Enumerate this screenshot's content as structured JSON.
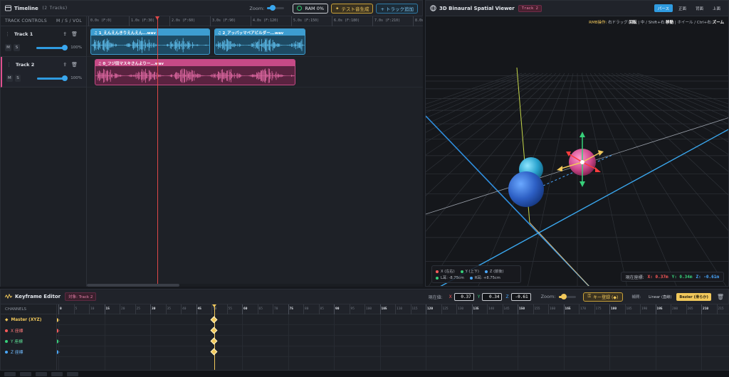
{
  "timeline": {
    "title": "Timeline",
    "track_count": "(2 Tracks)",
    "zoom_label": "Zoom:",
    "zoom_level": 0.3,
    "ram_label": "RAM 0%",
    "test_label": "テスト音生成",
    "add_track_label": "+ トラック追加",
    "controls_header": "TRACK CONTROLS",
    "controls_ms": "M / S / VOL",
    "ruler": [
      "0.0s (F:0)",
      "1.0s (F:30)",
      "2.0s (F:60)",
      "3.0s (F:90)",
      "4.0s (F:120)",
      "5.0s (F:150)",
      "6.0s (F:180)",
      "7.0s (F:210)",
      "8.0s (F:240)"
    ],
    "playhead_seconds": 1.7,
    "tracks": [
      {
        "name": "Track 1",
        "volume": "100%",
        "volume_level": 1.0,
        "clips": [
          {
            "label": "♫ 1_えんえんきりえんえん...wav",
            "start": 0.05,
            "end": 3.0
          },
          {
            "label": "♫ 2_アッパッマペアビルダー...wav",
            "start": 3.1,
            "end": 5.35
          }
        ]
      },
      {
        "name": "Track 2",
        "volume": "100%",
        "volume_level": 1.0,
        "clips": [
          {
            "label": "♫ 0_フジ田マスキさんよりー...wav",
            "start": 0.15,
            "end": 5.1
          }
        ]
      }
    ],
    "mute_label": "M",
    "solo_label": "S"
  },
  "viewer": {
    "title": "3D Binaural Spatial Viewer",
    "track_badge": "Track 2",
    "views": [
      "パース",
      "正面",
      "背面",
      "上面"
    ],
    "active_view": "パース",
    "hint_prefix": "RMB操作:",
    "hint_parts": [
      {
        "t": "右ドラッグ:",
        "b": "回転"
      },
      {
        "t": "中 / Shift+右:",
        "b": "移動"
      },
      {
        "t": "ホイール / Ctrl+右:",
        "b": "ズーム"
      }
    ],
    "legend": {
      "x": "X (左右)",
      "y": "Y (上下)",
      "z": "Z (前後)",
      "l_ear": "L耳: -8.75cm",
      "r_ear": "R耳: +8.75cm"
    },
    "coords_label": "現在座標:",
    "coord_x": "X: 0.37m",
    "coord_y": "Y: 0.34m",
    "coord_z": "Z: -0.61m",
    "colors": {
      "x": "#ff5a5a",
      "y": "#37d07a",
      "z": "#4aa8ff"
    }
  },
  "keyframe": {
    "title": "Keyframe Editor",
    "target": "対象: Track 2",
    "current_label": "現在値:",
    "x": "0.37",
    "y": "0.34",
    "z": "-0.61",
    "zoom_label": "Zoom:",
    "zoom_level": 0.3,
    "register_label": "キー登録 (◆)",
    "interp_label": "補間:",
    "interp_linear": "Linear (直線)",
    "interp_bezier": "Bezier (滑らか)",
    "channels_header": "CHANNELS",
    "channels": [
      {
        "name": "Master (XYZ)",
        "color": "#f1c85b"
      },
      {
        "name": "X 座標",
        "color": "#ff5a5a"
      },
      {
        "name": "Y 座標",
        "color": "#37d07a"
      },
      {
        "name": "Z 座標",
        "color": "#4aa8ff"
      }
    ],
    "ruler_major": [
      "0",
      "15",
      "30",
      "45",
      "60",
      "75",
      "90",
      "105",
      "120",
      "135",
      "150",
      "165",
      "180",
      "195",
      "210"
    ],
    "keyframe_frame": 51,
    "playhead_frame": 51
  }
}
